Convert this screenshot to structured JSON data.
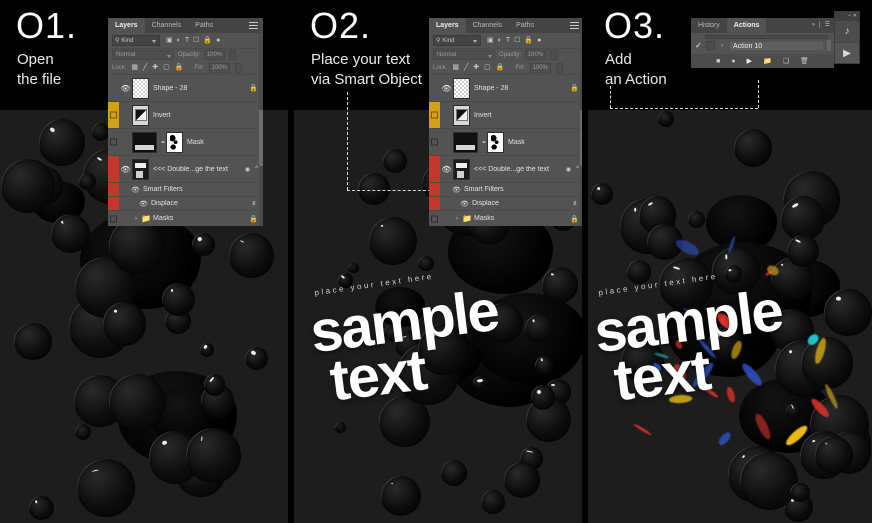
{
  "steps": [
    {
      "number": "O1.",
      "desc": "Open\nthe file"
    },
    {
      "number": "O2.",
      "desc": "Place your text\nvia Smart Object"
    },
    {
      "number": "O3.",
      "desc": "Add\nan Action"
    }
  ],
  "layers_panel": {
    "tabs": [
      {
        "label": "Layers",
        "active": true
      },
      {
        "label": "Channels",
        "active": false
      },
      {
        "label": "Paths",
        "active": false
      }
    ],
    "filter": {
      "kind_label": "Kind",
      "search_icon": "search-icon",
      "filter_icons": [
        "pixel-layer-icon",
        "adjustment-layer-icon",
        "type-layer-icon",
        "shape-layer-icon",
        "smart-object-icon",
        "filter-toggle-icon"
      ]
    },
    "blend": {
      "mode": "Normal",
      "opacity_label": "Opacity:",
      "opacity_value": "100%"
    },
    "lock": {
      "label": "Lock:",
      "icons": [
        "lock-transparent-pixels-icon",
        "lock-image-pixels-icon",
        "lock-position-icon",
        "lock-artboard-nesting-icon",
        "lock-all-icon"
      ],
      "fill_label": "Fill:",
      "fill_value": "100%"
    },
    "rows": [
      {
        "name": "Shape - 28",
        "visible": true,
        "color_flag": "none",
        "thumb": "checker",
        "right_icon": "lock-icon",
        "indent": 0,
        "type": "layer"
      },
      {
        "name": "Invert",
        "visible": false,
        "color_flag": "yellow",
        "thumb": "invert",
        "right_icon": "",
        "indent": 0,
        "type": "adjustment"
      },
      {
        "name": "Mask",
        "visible": false,
        "color_flag": "none",
        "thumb": "mask",
        "right_icon": "",
        "indent": 0,
        "type": "masked-layer"
      },
      {
        "name": "<<< Double...ge the text",
        "visible": true,
        "color_flag": "red",
        "thumb": "smart-object",
        "right_icon": "smart-filter-icon",
        "indent": 0,
        "type": "smart-object"
      },
      {
        "name": "Smart Filters",
        "visible": true,
        "color_flag": "red",
        "thumb": "",
        "right_icon": "",
        "indent": 1,
        "type": "smart-filter-group"
      },
      {
        "name": "Displace",
        "visible": true,
        "color_flag": "red",
        "thumb": "",
        "right_icon": "filter-settings-icon",
        "indent": 2,
        "type": "smart-filter"
      },
      {
        "name": "Masks",
        "visible": false,
        "color_flag": "none",
        "thumb": "folder",
        "right_icon": "lock-icon",
        "indent": 0,
        "type": "group"
      }
    ]
  },
  "actions_panel": {
    "tabs": [
      {
        "label": "History",
        "active": false
      },
      {
        "label": "Actions",
        "active": true
      }
    ],
    "collapse_icon": "chevron-double-right-icon",
    "menu_icon": "panel-menu-icon",
    "row": {
      "checked": "✓",
      "caret": "›",
      "name": "Action 10"
    },
    "toolbar_icons": [
      "stop-icon",
      "record-icon",
      "play-icon",
      "new-set-icon",
      "new-action-icon",
      "delete-icon"
    ]
  },
  "mini_palette": {
    "minimize_icon": "–",
    "close_icon": "✕",
    "record_stop_icon": "record-stop-icon",
    "play_icon": "play-icon"
  },
  "artwork": {
    "sub_text": "place your text here",
    "word_1": "sample",
    "word_2": "text"
  },
  "colors": {
    "background": "#000000",
    "artwork_bg": "#1d1d1d",
    "panel_bg": "#535353",
    "panel_tab_bg": "#444444",
    "flag_yellow": "#d4a017",
    "flag_red": "#c0392b",
    "text_primary": "#ffffff",
    "chroma_red": "#e0342b",
    "chroma_cyan": "#25c9d0",
    "chroma_yellow": "#f2c015",
    "chroma_blue": "#2f55c8"
  }
}
